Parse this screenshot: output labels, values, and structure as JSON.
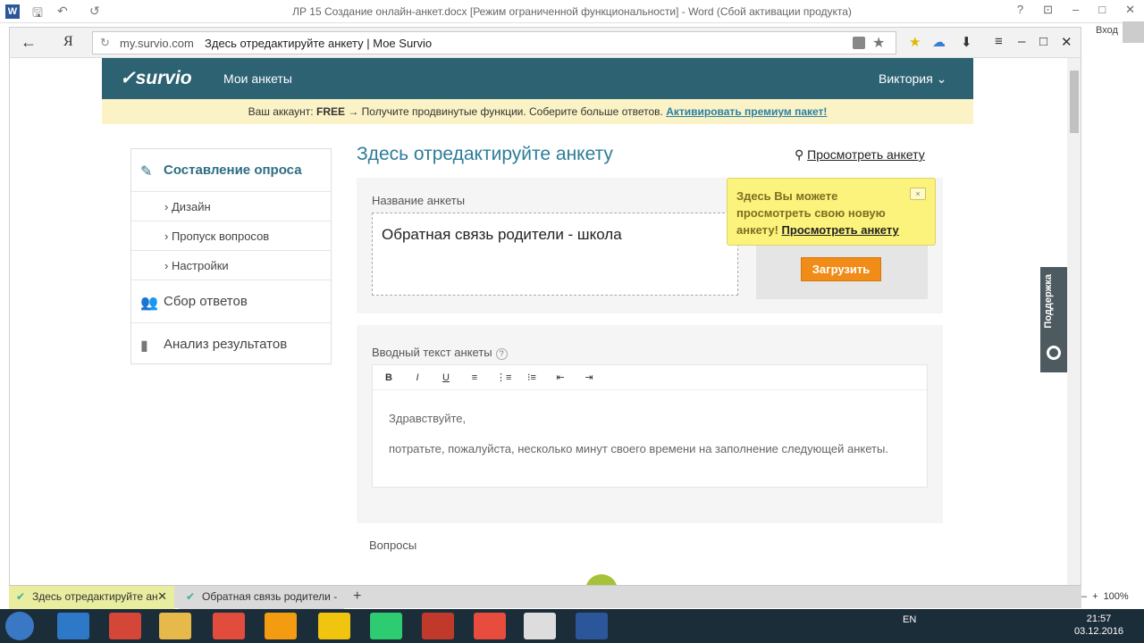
{
  "word": {
    "title": "ЛР 15 Создание онлайн-анкет.docx [Режим ограниченной функциональности] - Word (Сбой активации продукта)",
    "login": "Вход",
    "icon_letter": "W",
    "controls": [
      "?",
      "⊡",
      "–",
      "□",
      "✕"
    ]
  },
  "browser": {
    "back": "←",
    "yandex": "Я",
    "domain": "my.survio.com",
    "page_title": "Здесь отредактируйте анкету | Мое Survio",
    "menu": "≡",
    "controls": [
      "–",
      "□",
      "✕"
    ]
  },
  "survio": {
    "logo": "✓survio",
    "my_forms": "Мои анкеты",
    "user": "Виктория",
    "user_caret": "⌄",
    "banner": {
      "prefix": "Ваш аккаунт:",
      "plan": "FREE",
      "middle": "→ Получите продвинутые функции. Соберите больше ответов.",
      "link": "Активировать премиум пакет!"
    }
  },
  "sidebar": {
    "compose": "Составление опроса",
    "design": "› Дизайн",
    "skip": "› Пропуск вопросов",
    "settings": "› Настройки",
    "collect": "Сбор ответов",
    "analysis": "Анализ результатов"
  },
  "main": {
    "title": "Здесь отредактируйте анкету",
    "preview_link": "Просмотреть анкету",
    "name_label": "Название анкеты",
    "name_value": "Обратная связь родители - школа",
    "upload": "Загрузить",
    "tooltip_text": "Здесь Вы можете просмотреть свою новую анкету!",
    "tooltip_link": "Просмотреть анкету",
    "tooltip_close": "×",
    "intro_label": "Вводный текст анкеты",
    "help": "?",
    "toolbar": [
      "B",
      "I",
      "U",
      "≡",
      "⋮≡",
      "⁝≡",
      "⇤",
      "⇥"
    ],
    "intro_line1": "Здравствуйте,",
    "intro_line2": "потратьте, пожалуйста, несколько минут своего времени на заполнение следующей анкеты.",
    "questions": "Вопросы",
    "support": "Поддержка"
  },
  "tabs": {
    "tab1": "Здесь отредактируйте ан",
    "tab2": "Обратная связь родители -",
    "close": "✕",
    "add": "+",
    "zoom_minus": "–",
    "zoom_plus": "+",
    "zoom": "100%"
  },
  "taskbar": {
    "lang": "EN",
    "time": "21:57",
    "date": "03.12.2016"
  },
  "colors": {
    "header": "#2d6273",
    "accent": "#2d7c99",
    "upload": "#f08c17",
    "tooltip": "#fbf37c"
  }
}
